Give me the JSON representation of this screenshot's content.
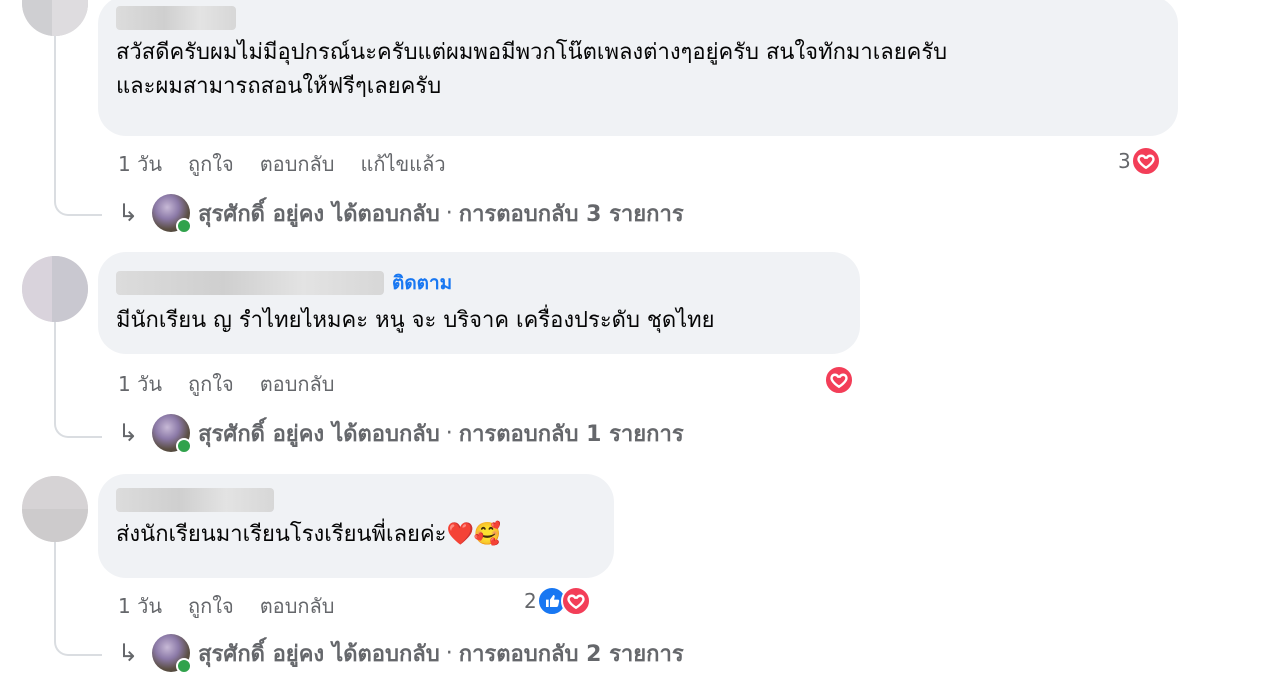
{
  "comments": [
    {
      "text": "สวัสดีครับผมไม่มีอุปกรณ์นะครับแต่ผมพอมีพวกโน๊ตเพลงต่างๆอยู่ครับ สนใจทักมาเลยครับ\nและผมสามารถสอนให้ฟรีๆเลยครับ",
      "time": "1 วัน",
      "like_label": "ถูกใจ",
      "reply_label": "ตอบกลับ",
      "edited_label": "แก้ไขแล้ว",
      "reaction_count": "3",
      "reactions": [
        "love-icon"
      ],
      "reply_summary": {
        "name": "สุรศักดิ์ อยู่คง",
        "action": "ได้ตอบกลับ",
        "separator": "·",
        "count_text": "การตอบกลับ 3 รายการ"
      }
    },
    {
      "follow_label": "ติดตาม",
      "text": "มีนักเรียน ญ รำไทยไหมคะ หนู จะ บริจาค เครื่องประดับ ชุดไทย",
      "time": "1 วัน",
      "like_label": "ถูกใจ",
      "reply_label": "ตอบกลับ",
      "reaction_count": "",
      "reactions": [
        "love-icon"
      ],
      "reply_summary": {
        "name": "สุรศักดิ์ อยู่คง",
        "action": "ได้ตอบกลับ",
        "separator": "·",
        "count_text": "การตอบกลับ 1 รายการ"
      }
    },
    {
      "text": "ส่งนักเรียนมาเรียนโรงเรียนพี่เลยค่ะ❤️🥰",
      "time": "1 วัน",
      "like_label": "ถูกใจ",
      "reply_label": "ตอบกลับ",
      "reaction_count": "2",
      "reactions": [
        "like-icon",
        "love-icon"
      ],
      "reply_summary": {
        "name": "สุรศักดิ์ อยู่คง",
        "action": "ได้ตอบกลับ",
        "separator": "·",
        "count_text": "การตอบกลับ 2 รายการ"
      }
    }
  ],
  "colors": {
    "bubble": "#f0f2f5",
    "love": "#f33e58",
    "like": "#1877f2",
    "meta_text": "#65676b",
    "follow_link": "#1877f2",
    "online": "#31a24c"
  },
  "icons": {
    "reply_arrow": "↳",
    "heart": "♥",
    "thumbs_up": "👍"
  }
}
